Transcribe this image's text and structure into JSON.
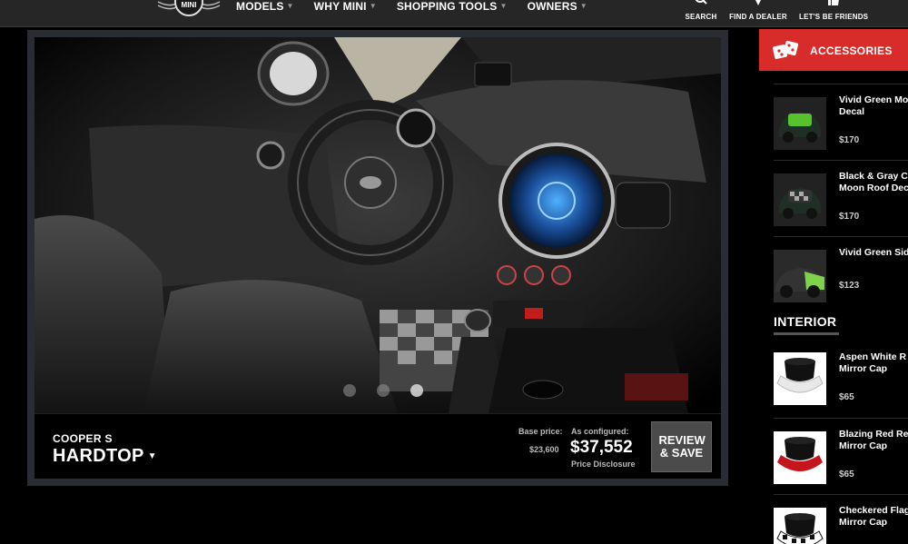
{
  "nav": {
    "logo_text": "MINI",
    "items": [
      {
        "label": "MODELS"
      },
      {
        "label": "WHY MINI"
      },
      {
        "label": "SHOPPING TOOLS"
      },
      {
        "label": "OWNERS"
      }
    ],
    "utilities": [
      {
        "label": "SEARCH",
        "icon": "search-icon"
      },
      {
        "label": "FIND A DEALER",
        "icon": "location-pin-icon"
      },
      {
        "label": "LET'S BE FRIENDS",
        "icon": "thumbs-up-icon"
      }
    ]
  },
  "configurator": {
    "model_sub": "COOPER S",
    "model_main": "HARDTOP",
    "base_label": "Base price:",
    "base_price": "$23,600",
    "configured_label": "As configured:",
    "configured_price": "$37,552",
    "price_disclosure": "Price Disclosure",
    "review_button": "REVIEW & SAVE",
    "dots": 3,
    "active_dot": 3
  },
  "sidebar": {
    "tab_label": "ACCESSORIES",
    "tab_icon": "dice-icon",
    "accent_color": "#d72c2a",
    "exterior_items": [
      {
        "name_line1": "Vivid Green Mo",
        "name_line2": "Decal",
        "price": "$170",
        "thumb": "green-roof-decal"
      },
      {
        "name_line1": "Black & Gray C",
        "name_line2": "Moon Roof Dec",
        "price": "$170",
        "thumb": "checker-roof-decal"
      },
      {
        "name_line1": "Vivid Green Sid",
        "name_line2": "",
        "price": "$123",
        "thumb": "green-side-decal"
      }
    ],
    "interior_heading": "INTERIOR",
    "interior_items": [
      {
        "name_line1": "Aspen White R",
        "name_line2": "Mirror Cap",
        "price": "$65",
        "cap_color": "#e8e8e8"
      },
      {
        "name_line1": "Blazing Red Re",
        "name_line2": "Mirror Cap",
        "price": "$65",
        "cap_color": "#c4161c"
      },
      {
        "name_line1": "Checkered Flag",
        "name_line2": "Mirror Cap",
        "price": "",
        "cap_color": "#ffffff"
      }
    ]
  }
}
